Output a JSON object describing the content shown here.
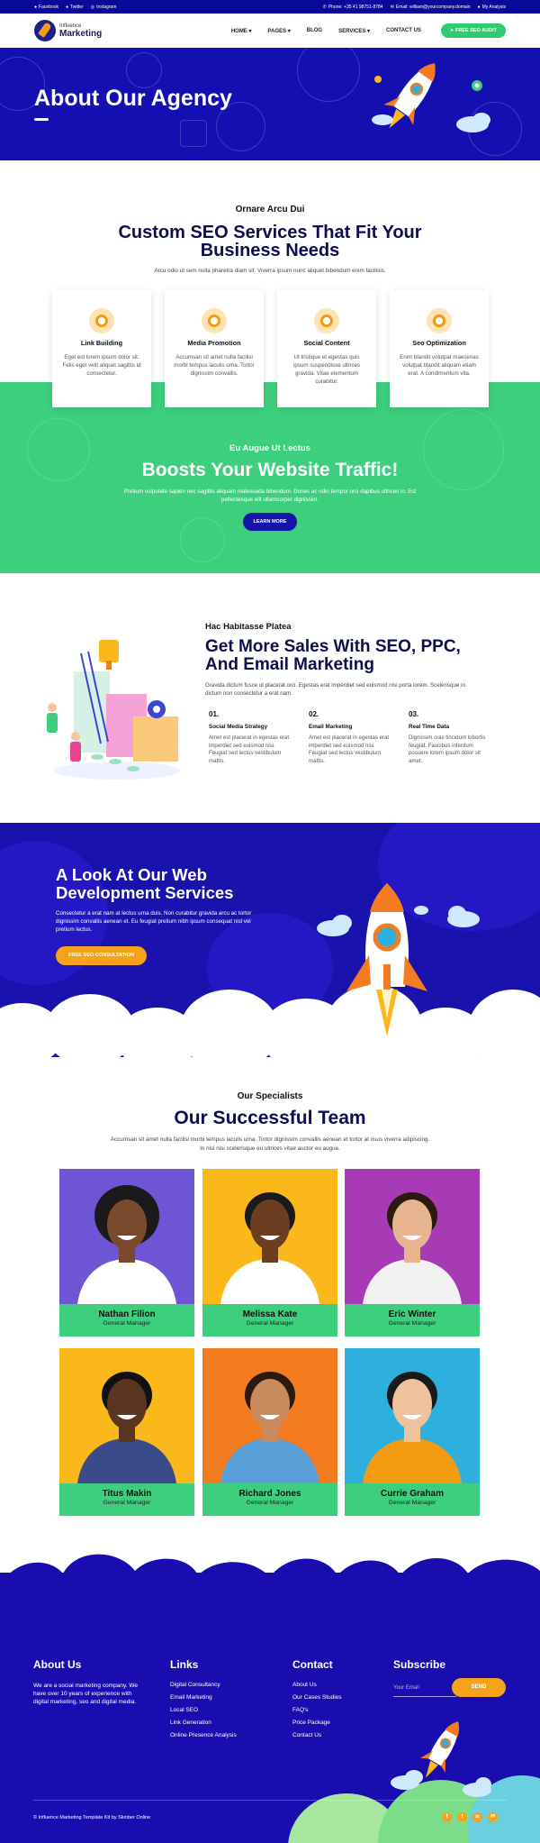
{
  "topbar": {
    "facebook": "Facebook",
    "twitter": "Twitter",
    "instagram": "Instagram",
    "phone": "Phone: +35 41 98751-8784",
    "email": "Email: william@yourcompany.domain",
    "account": "My Analysis"
  },
  "nav": {
    "logo_small": "Influence",
    "logo_big": "Marketing",
    "items": [
      "HOME",
      "PAGES",
      "BLOG",
      "SERVICES",
      "CONTACT US"
    ],
    "cta": "FREE SEO AUDIT"
  },
  "hero": {
    "title": "About Our Agency"
  },
  "services": {
    "subtitle": "Ornare Arcu Dui",
    "title_line1": "Custom SEO Services That Fit Your",
    "title_line2": "Business Needs",
    "description": "Arcu odio ut sem nulla pharetra diam sit. Viverra ipsum nunc aliquet bibendum enim facilisis.",
    "cards": [
      {
        "title": "Link Building",
        "text": "Eget est lorem ipsum dolor sit. Felis eget velit aliquet sagittis id consectetur."
      },
      {
        "title": "Media Promotion",
        "text": "Accumsan sit amet nulla facilisi morbi tempus iaculis urna. Tortor dignissim convallis."
      },
      {
        "title": "Social Content",
        "text": "Ut tristique et egestas quis ipsum suspendisse ultrices gravida. Vitae elementum curabitur."
      },
      {
        "title": "Seo Optimization",
        "text": "Enim blandit volutpat maecenas volutpat blandit aliquam etiam erat. A condimentum vita."
      }
    ]
  },
  "traffic": {
    "subtitle": "Eu Augue Ut Lectus",
    "title": "Boosts Your Website Traffic!",
    "text_line1": "Pretium vulputate sapien nec sagittis aliquam malesuada bibendum. Donec ac odio tempor orci dapibus ultrices in. Est",
    "text_line2": "pellentesque elit ullamcorper dignissim.",
    "button": "LEARN MORE"
  },
  "sales": {
    "subtitle": "Hac Habitasse Platea",
    "title_line1": "Get More Sales With SEO, PPC,",
    "title_line2": "And Email Marketing",
    "text_line1": "Gravida dictum fusce ut placerat orci. Egestas erat imperdiet sed euismod nisi porta lorem. Scelerisque in",
    "text_line2": "dictum non consectetur a erat nam.",
    "items": [
      {
        "num": "01.",
        "title": "Social Media Strategy",
        "text": "Amet est placerat in egestas erat imperdiet sed euismod nisi. Feugiat sed lectus vestibulum mattis."
      },
      {
        "num": "02.",
        "title": "Email Marketing",
        "text": "Amet est placerat in egestas erat imperdiet sed euismod nisi. Feugiat sed lectus vestibulum mattis."
      },
      {
        "num": "03.",
        "title": "Real Time Data",
        "text": "Dignissim cras tincidunt lobortis feugiat. Faucibus interdum posuere lorem ipsum dolor sit amet."
      }
    ]
  },
  "dev": {
    "title_line1": "A Look At Our Web",
    "title_line2": "Development Services",
    "text_line1": "Consectetur a erat nam at lectus urna duis. Non curabitur gravida arcu ac tortor",
    "text_line2": "dignissim convallis aenean et. Eu feugiat pretium nibh ipsum consequat nisl vel",
    "text_line3": "pretium lectus.",
    "button": "FREE SEO CONSULTATION"
  },
  "team": {
    "subtitle": "Our Specialists",
    "title": "Our Successful Team",
    "text_line1": "Accumsan sit amet nulla facilisi morbi tempus iaculis urna. Tortor dignissim convallis aenean et tortor at risus viverra adipiscing.",
    "text_line2": "In nisl nisi scelerisque eu ultrices vitae auctor eu augue.",
    "members": [
      {
        "name": "Nathan Filion",
        "role": "General Manager",
        "bg": "#6e55d6"
      },
      {
        "name": "Melissa Kate",
        "role": "General Manager",
        "bg": "#fbb81b"
      },
      {
        "name": "Eric Winter",
        "role": "General Manager",
        "bg": "#a63bb5"
      },
      {
        "name": "Titus Makin",
        "role": "General Manager",
        "bg": "#fbb81b"
      },
      {
        "name": "Richard Jones",
        "role": "General Manager",
        "bg": "#f27c1f"
      },
      {
        "name": "Currie Graham",
        "role": "General Manager",
        "bg": "#2db0dd"
      }
    ]
  },
  "footer": {
    "about_title": "About Us",
    "about_line1": "We are a social marketing company. We",
    "about_line2": "have over 10 years of experience with",
    "about_line3": "digital marketing, seo and digital media.",
    "links_title": "Links",
    "links": [
      "Digital Consultancy",
      "Email Marketing",
      "Local SEO",
      "Link Generation",
      "Online Presence Analysis"
    ],
    "contact_title": "Contact",
    "contact": [
      "About Us",
      "Our Cases Studies",
      "FAQ's",
      "Price Package",
      "Contact Us"
    ],
    "subscribe_title": "Subscribe",
    "email_placeholder": "Your Email",
    "send": "SEND",
    "copyright": "© Influence Marketing Template Kit by Skinber Online",
    "social": [
      "f",
      "t",
      "in",
      "✉"
    ]
  }
}
